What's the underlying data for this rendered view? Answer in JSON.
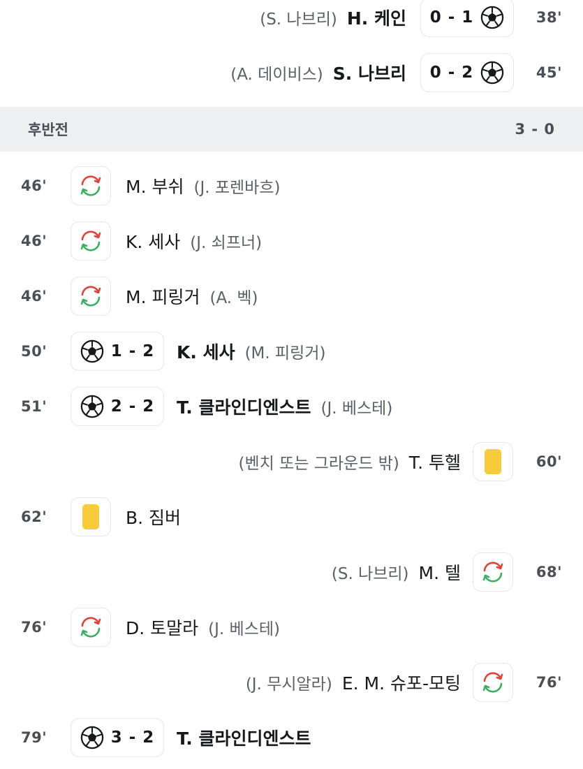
{
  "first_half_events": [
    {
      "assist": "(S. 나브리)",
      "player": "H. 케인",
      "score": "0 - 1",
      "minute": "38'"
    },
    {
      "assist": "(A. 데이비스)",
      "player": "S. 나브리",
      "score": "0 - 2",
      "minute": "45'"
    }
  ],
  "second_half": {
    "label": "후반전",
    "score": "3 - 0"
  },
  "second_half_events": [
    {
      "minute": "46'",
      "player": "M. 부쉬",
      "assist": "(J. 포렌바흐)"
    },
    {
      "minute": "46'",
      "player": "K. 세사",
      "assist": "(J. 쇠프너)"
    },
    {
      "minute": "46'",
      "player": "M. 피링거",
      "assist": "(A. 벡)"
    },
    {
      "minute": "50'",
      "score": "1 - 2",
      "player": "K. 세사",
      "assist": "(M. 피링거)"
    },
    {
      "minute": "51'",
      "score": "2 - 2",
      "player": "T. 클라인디엔스트",
      "assist": "(J. 베스테)"
    },
    {
      "minute": "60'",
      "player": "T. 투헬",
      "assist": "(벤치 또는 그라운드 밖)"
    },
    {
      "minute": "62'",
      "player": "B. 짐버"
    },
    {
      "minute": "68'",
      "player": "M. 텔",
      "assist": "(S. 나브리)"
    },
    {
      "minute": "76'",
      "player": "D. 토말라",
      "assist": "(J. 베스테)"
    },
    {
      "minute": "76'",
      "player": "E. M. 슈포-모팅",
      "assist": "(J. 무시알라)"
    },
    {
      "minute": "79'",
      "score": "3 - 2",
      "player": "T. 클라인디엔스트"
    }
  ],
  "icons": {
    "goal": "soccer-ball-icon",
    "substitution": "substitution-arrows-icon",
    "yellow_card": "yellow-card-icon"
  },
  "colors": {
    "sub_arrow_red": "#e0433a",
    "sub_arrow_green": "#3cb061",
    "yellow_card": "#f7cc3a",
    "half_bar_bg": "#eeeff1"
  }
}
